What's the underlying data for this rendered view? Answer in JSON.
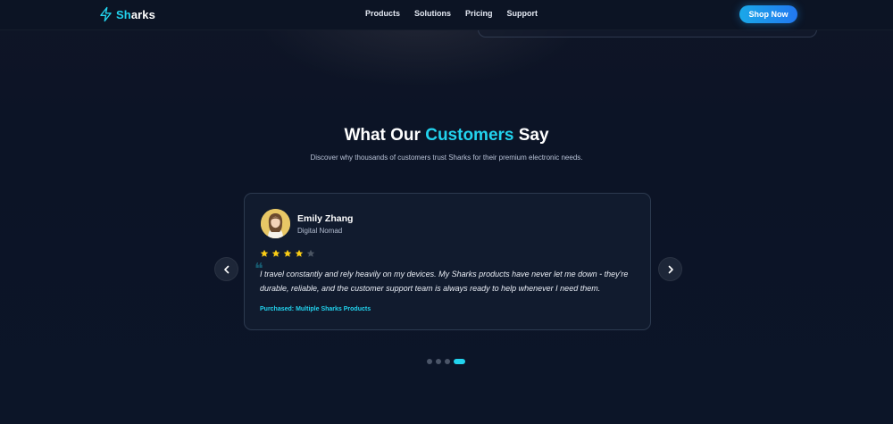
{
  "brand": {
    "logo_prefix": "Sh",
    "logo_suffix": "arks",
    "accent_color": "#22d3ee",
    "icon": "lightning-bolt-icon"
  },
  "nav": {
    "links": [
      "Products",
      "Solutions",
      "Pricing",
      "Support"
    ],
    "cta_label": "Shop Now"
  },
  "testimonials": {
    "heading_before": "What Our ",
    "heading_accent": "Customers",
    "heading_after": " Say",
    "subtitle": "Discover why thousands of customers trust Sharks for their premium electronic needs.",
    "current": {
      "name": "Emily Zhang",
      "role": "Digital Nomad",
      "rating": 4,
      "rating_max": 5,
      "review": "I travel constantly and rely heavily on my devices. My Sharks products have never let me down - they're durable, reliable, and the customer support team is always ready to help whenever I need them.",
      "purchased": "Purchased: Multiple Sharks Products"
    },
    "carousel": {
      "slide_count": 4,
      "active_index": 3,
      "prev_icon": "chevron-left-icon",
      "next_icon": "chevron-right-icon"
    }
  },
  "colors": {
    "background": "#0d1426",
    "star_filled": "#facc15",
    "star_empty": "#4b5563",
    "button_gradient_start": "#1aa8e8",
    "button_gradient_end": "#2278f0"
  }
}
